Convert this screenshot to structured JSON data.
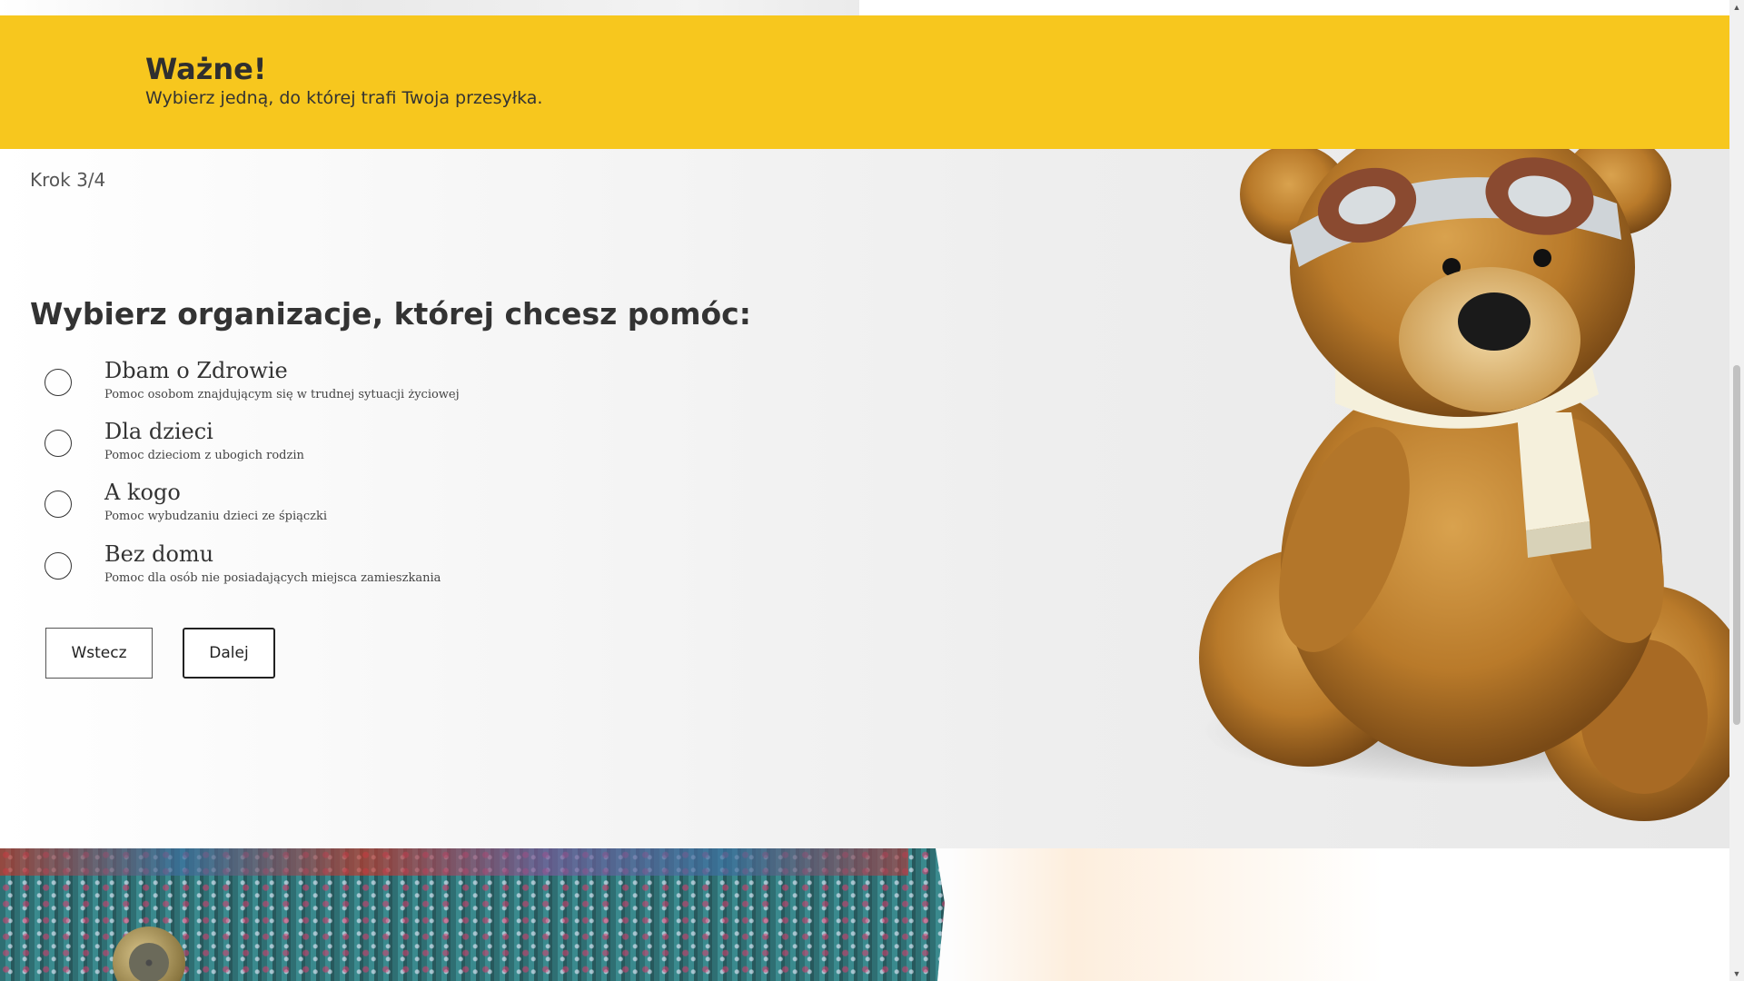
{
  "banner": {
    "title": "Ważne!",
    "text": "Wybierz jedną, do której trafi Twoja przesyłka."
  },
  "form": {
    "step": "Krok 3/4",
    "question": "Wybierz organizacje, której chcesz pomóc:",
    "options": [
      {
        "label": "Dbam o Zdrowie",
        "description": "Pomoc osobom znajdującym się w trudnej sytuacji życiowej",
        "selected": false
      },
      {
        "label": "Dla dzieci",
        "description": "Pomoc dzieciom z ubogich rodzin",
        "selected": false
      },
      {
        "label": "A kogo",
        "description": "Pomoc wybudzaniu dzieci ze śpiączki",
        "selected": false
      },
      {
        "label": "Bez domu",
        "description": "Pomoc dla osób nie posiadających miejsca zamieszkania",
        "selected": false
      }
    ],
    "back_label": "Wstecz",
    "next_label": "Dalej"
  },
  "scrollbar": {
    "up_icon": "▲",
    "down_icon": "▼"
  },
  "colors": {
    "banner": "#f7c71e",
    "text": "#333333"
  }
}
